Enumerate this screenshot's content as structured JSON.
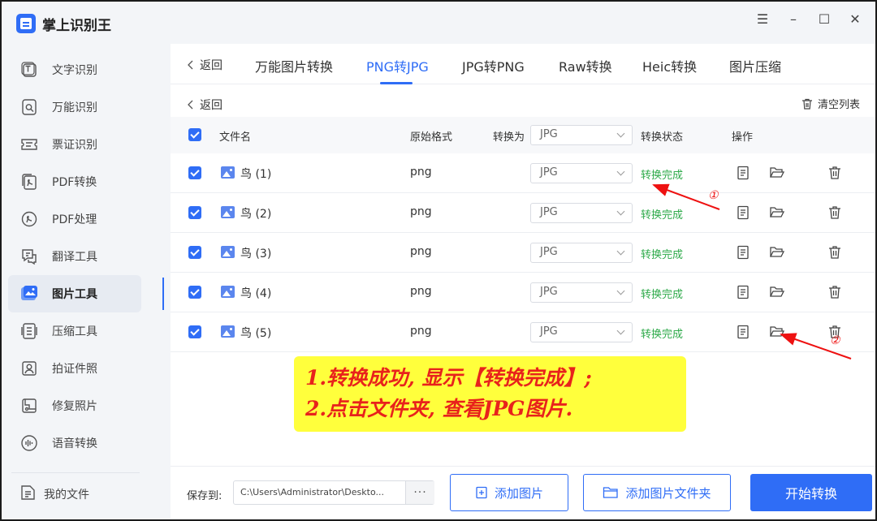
{
  "app": {
    "title": "掌上识别王"
  },
  "sidebar": {
    "items": [
      {
        "label": "文字识别",
        "icon": "text-recognition-icon"
      },
      {
        "label": "万能识别",
        "icon": "universal-scan-icon"
      },
      {
        "label": "票证识别",
        "icon": "ticket-icon"
      },
      {
        "label": "PDF转换",
        "icon": "pdf-convert-icon"
      },
      {
        "label": "PDF处理",
        "icon": "pdf-process-icon"
      },
      {
        "label": "翻译工具",
        "icon": "translate-icon"
      },
      {
        "label": "图片工具",
        "icon": "image-tool-icon",
        "active": true
      },
      {
        "label": "压缩工具",
        "icon": "compress-icon"
      },
      {
        "label": "拍证件照",
        "icon": "id-photo-icon"
      },
      {
        "label": "修复照片",
        "icon": "photo-repair-icon"
      },
      {
        "label": "语音转换",
        "icon": "voice-convert-icon"
      }
    ],
    "my_files": "我的文件"
  },
  "window_controls": {
    "menu": "☰",
    "minimize": "–",
    "maximize": "☐",
    "close": "✕"
  },
  "topnav": {
    "back": "返回",
    "tabs": [
      "万能图片转换",
      "PNG转JPG",
      "JPG转PNG",
      "Raw转换",
      "Heic转换",
      "图片压缩"
    ],
    "active_tab": "PNG转JPG"
  },
  "list": {
    "back": "返回",
    "clear": "清空列表",
    "headers": {
      "file": "文件名",
      "orig": "原始格式",
      "convert_to": "转换为",
      "convert_to_value": "JPG",
      "status": "转换状态",
      "actions": "操作"
    },
    "rows": [
      {
        "name": "鸟 (1)",
        "orig": "png",
        "target": "JPG",
        "status": "转换完成"
      },
      {
        "name": "鸟 (2)",
        "orig": "png",
        "target": "JPG",
        "status": "转换完成"
      },
      {
        "name": "鸟 (3)",
        "orig": "png",
        "target": "JPG",
        "status": "转换完成"
      },
      {
        "name": "鸟 (4)",
        "orig": "png",
        "target": "JPG",
        "status": "转换完成"
      },
      {
        "name": "鸟 (5)",
        "orig": "png",
        "target": "JPG",
        "status": "转换完成"
      }
    ]
  },
  "bottom": {
    "save_label": "保存到:",
    "path": "C:\\Users\\Administrator\\Deskto...",
    "more": "···",
    "add_image": "添加图片",
    "add_folder": "添加图片文件夹",
    "start": "开始转换"
  },
  "annotation": {
    "line1": "1.转换成功, 显示【转换完成】;",
    "line2": "2.点击文件夹, 查看JPG图片.",
    "marker1": "①",
    "marker2": "②"
  },
  "colors": {
    "accent": "#2f6df6",
    "success": "#2eaa4a",
    "annotation_bg": "#ffff3c",
    "annotation_text": "#e8221c"
  }
}
